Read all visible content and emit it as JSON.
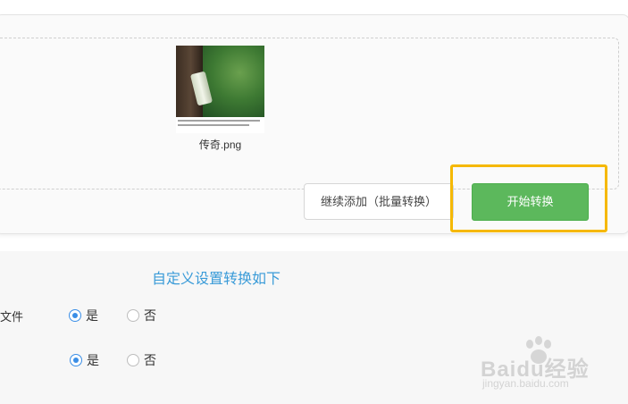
{
  "upload": {
    "file_name": "传奇.png"
  },
  "actions": {
    "add_more_label": "继续添加（批量转换）",
    "start_label": "开始转换"
  },
  "settings": {
    "title": "自定义设置转换如下",
    "rows": [
      {
        "label": "文件",
        "options": [
          "是",
          "否"
        ],
        "selected": "是"
      },
      {
        "label": "",
        "options": [
          "是",
          "否"
        ],
        "selected": "是"
      }
    ]
  },
  "watermark": {
    "brand": "Baidu经验",
    "sub": "jingyan.baidu.com"
  },
  "colors": {
    "primary_button": "#5cb85c",
    "highlight": "#f5b800",
    "title_link": "#3a9bd8",
    "radio_checked": "#3a8ee6"
  }
}
